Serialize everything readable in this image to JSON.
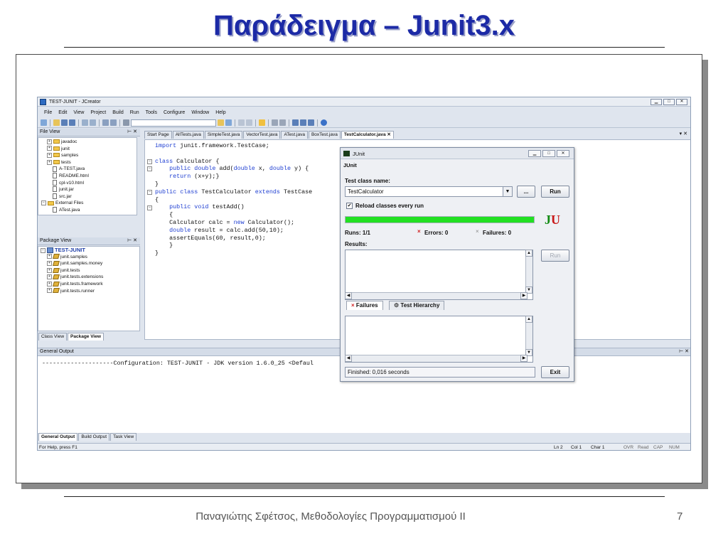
{
  "slide": {
    "title": "Παράδειγμα – Junit3.x",
    "footer": "Παναγιώτης Σφέτσος, Μεθοδολογίες Προγραμματισμού ΙΙ",
    "page_number": "7"
  },
  "ide": {
    "window_title": "TEST-JUNIT - JCreator",
    "menu": [
      "File",
      "Edit",
      "View",
      "Project",
      "Build",
      "Run",
      "Tools",
      "Configure",
      "Window",
      "Help"
    ],
    "file_view": {
      "header": "File View",
      "items": [
        {
          "label": "javadoc",
          "kind": "folder",
          "depth": 1,
          "expand": "+"
        },
        {
          "label": "junit",
          "kind": "folder",
          "depth": 1,
          "expand": "+"
        },
        {
          "label": "samples",
          "kind": "folder",
          "depth": 1,
          "expand": "+"
        },
        {
          "label": "tests",
          "kind": "folder",
          "depth": 1,
          "expand": "+"
        },
        {
          "label": "A-TEST.java",
          "kind": "file",
          "depth": 2,
          "expand": ""
        },
        {
          "label": "README.html",
          "kind": "file",
          "depth": 2,
          "expand": ""
        },
        {
          "label": "cpl-v10.html",
          "kind": "file",
          "depth": 2,
          "expand": ""
        },
        {
          "label": "junit.jar",
          "kind": "file",
          "depth": 2,
          "expand": ""
        },
        {
          "label": "src.jar",
          "kind": "file",
          "depth": 2,
          "expand": ""
        },
        {
          "label": "External Files",
          "kind": "folder",
          "depth": 0,
          "expand": "-"
        },
        {
          "label": "ATest.java",
          "kind": "file",
          "depth": 2,
          "expand": ""
        }
      ]
    },
    "package_view": {
      "header": "Package View",
      "root": "TEST-JUNIT",
      "items": [
        "junit.samples",
        "junit.samples.money",
        "junit.tests",
        "junit.tests.extensions",
        "junit.tests.framework",
        "junit.tests.runner"
      ]
    },
    "left_tabs": [
      "Class View",
      "Package View"
    ],
    "editor_tabs": [
      "Start Page",
      "AllTests.java",
      "SimpleTest.java",
      "VectorTest.java",
      "ATest.java",
      "BoxTest.java",
      "TestCalculator.java"
    ],
    "active_tab": "TestCalculator.java",
    "code_lines": [
      "import junit.framework.TestCase;",
      "",
      "class Calculator {",
      "    public double add(double x, double y) {",
      "    return (x+y);}",
      "}",
      "public class TestCalculator extends TestCase",
      "{",
      "    public void testAdd()",
      "    {",
      "    Calculator calc = new Calculator();",
      "    double result = calc.add(50,10);",
      "    assertEquals(60, result,0);",
      "    }",
      "}"
    ],
    "output": {
      "header": "General Output",
      "line": "--------------------Configuration: TEST-JUNIT - JDK version 1.6.0_25 <Defaul"
    },
    "bottom_tabs": [
      "General Output",
      "Build Output",
      "Task View"
    ],
    "status": {
      "left": "For Help, press F1",
      "right": [
        "Ln 2",
        "Col 1",
        "Char 1",
        "OVR",
        "Read",
        "CAP",
        "NUM"
      ]
    }
  },
  "junit": {
    "window_title": "JUnit",
    "menu": "JUnit",
    "test_class_label": "Test class name:",
    "test_class_value": "TestCalculator",
    "browse_label": "...",
    "run_label": "Run",
    "reload_label": "Reload classes every run",
    "reload_checked": "✔",
    "progress": 1.0,
    "runs": "Runs:  1/1",
    "errors": "Errors:  0",
    "failures": "Failures:  0",
    "results_label": "Results:",
    "run2_label": "Run",
    "tab_failures": "Failures",
    "tab_hierarchy": "Test Hierarchy",
    "finished": "Finished: 0,016 seconds",
    "exit_label": "Exit",
    "logo_j": "J",
    "logo_u": "U",
    "colors": {
      "progress": "#22e022",
      "error_x": "#d11d1d"
    }
  }
}
